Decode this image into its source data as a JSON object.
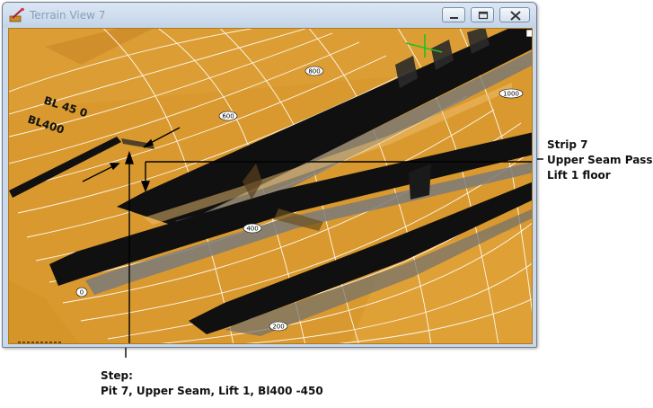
{
  "window": {
    "title": "Terrain View 7",
    "accent": "#d9992e"
  },
  "terrain": {
    "contours": [
      "800",
      "1000",
      "600",
      "400",
      "200",
      "0"
    ],
    "bl_labels": [
      "BL 45 0",
      "BL400"
    ]
  },
  "annotations": {
    "strip": {
      "line1": "Strip 7",
      "line2": "Upper Seam Pass",
      "line3": "Lift 1 floor"
    },
    "step": {
      "line1": "Step:",
      "line2": "Pit 7, Upper Seam, Lift 1, Bl400 -450"
    }
  }
}
